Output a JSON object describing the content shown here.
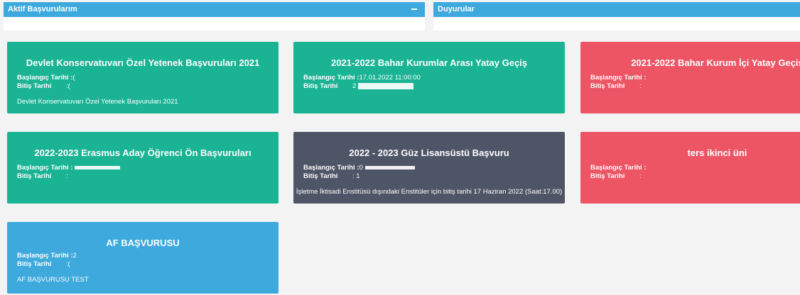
{
  "panels": {
    "active": {
      "title": "Aktif Başvurularım"
    },
    "announcements": {
      "title": "Duyurular"
    }
  },
  "labels": {
    "start": "Başlangıç Tarihi :",
    "end": "Bitiş Tarihi",
    "end_colon": ":"
  },
  "cards": [
    {
      "title": "Devlet Konservatuvarı Özel Yetenek Başvuruları 2021",
      "color": "#1ab394",
      "start_value": "(",
      "end_value": ":(",
      "description": "Devlet Konservatuvarı Özel Yetenek Başvuruları 2021"
    },
    {
      "title": "2021-2022 Bahar Kurumlar Arası Yatay Geçiş",
      "color": "#1ab394",
      "start_value": "17.01.2022 11:00:00",
      "end_value": "2",
      "description": ""
    },
    {
      "title": "2021-2022 Bahar Kurum İçi Yatay Geçiş",
      "color": "#ed5565",
      "start_value": "",
      "end_value": ":",
      "description": ""
    },
    {
      "title": "2022-2023 Erasmus Aday Öğrenci Ön Başvuruları",
      "color": "#1ab394",
      "start_value": "",
      "end_value": ":",
      "description": ""
    },
    {
      "title": "2022 - 2023 Güz Lisansüstü Başvuru",
      "color": "#4e5566",
      "start_value": "0",
      "end_value": ": 1",
      "description": "İşletme İktisadi Enstitüsü dışındaki Enstitüler için bitiş tarihi 17 Haziran 2022 (Saat:17.00)"
    },
    {
      "title": "ters ikinci üni",
      "color": "#ed5565",
      "start_value": "",
      "end_value": ":",
      "description": ""
    },
    {
      "title": "AF BAŞVURUSU",
      "color": "#3ea9dc",
      "start_value": "2",
      "end_value": ":(",
      "description": "AF BAŞVURUSU TEST"
    }
  ]
}
